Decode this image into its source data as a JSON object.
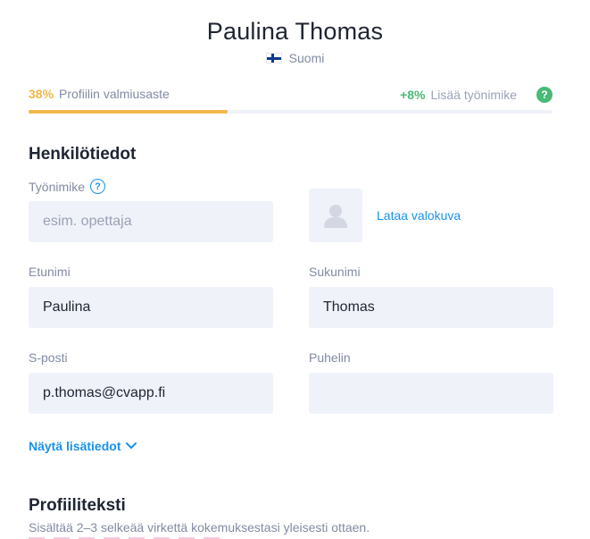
{
  "header": {
    "full_name": "Paulina Thomas",
    "country": "Suomi",
    "flag_icon": "finland-flag-icon"
  },
  "progress": {
    "percent_text": "38%",
    "percent_value": 38,
    "label": "Profiilin valmiusaste",
    "bonus_text": "+8%",
    "bonus_label": "Lisää työnimike",
    "fill_color": "#f0b74b",
    "bonus_color": "#48ba75"
  },
  "personal": {
    "title": "Henkilötiedot",
    "job_title_label": "Työnimike",
    "job_title_placeholder": "esim. opettaja",
    "job_title_value": "",
    "upload_photo": "Lataa valokuva",
    "first_name_label": "Etunimi",
    "first_name_value": "Paulina",
    "last_name_label": "Sukunimi",
    "last_name_value": "Thomas",
    "email_label": "S-posti",
    "email_value": "p.thomas@cvapp.fi",
    "phone_label": "Puhelin",
    "phone_value": "",
    "show_more": "Näytä lisätiedot"
  },
  "profile": {
    "title": "Profiiliteksti",
    "description": "Sisältää 2–3 selkeää virkettä kokemuksestasi yleisesti ottaen."
  },
  "colors": {
    "accent": "#1a91f0",
    "input_bg": "#eff2f9",
    "muted_text": "#828ba2"
  }
}
